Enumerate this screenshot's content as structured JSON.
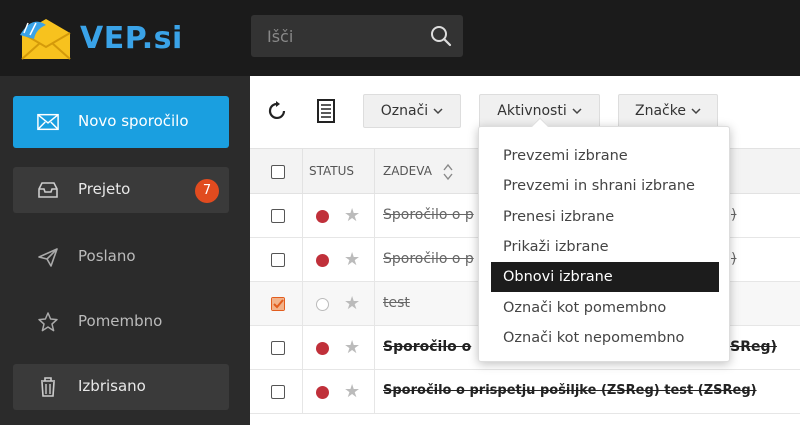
{
  "brand": {
    "name": "VEP.si",
    "accent": "#3aa3e8"
  },
  "search": {
    "placeholder": "Išči"
  },
  "sidebar": {
    "compose": {
      "label": "Novo sporočilo",
      "icon": "envelope-icon"
    },
    "items": [
      {
        "label": "Prejeto",
        "icon": "inbox-icon",
        "badge": "7"
      },
      {
        "label": "Poslano",
        "icon": "send-icon"
      },
      {
        "label": "Pomembno",
        "icon": "star-icon"
      },
      {
        "label": "Izbrisano",
        "icon": "trash-icon"
      }
    ]
  },
  "toolbar": {
    "oznaci": "Označi",
    "aktivnosti": "Aktivnosti",
    "znacke": "Značke"
  },
  "table": {
    "headers": {
      "status": "STATUS",
      "subject": "ZADEVA"
    },
    "rows": [
      {
        "checked": false,
        "status": "red",
        "subject_left": "Sporočilo o p",
        "subject_right": ")",
        "bold": false
      },
      {
        "checked": false,
        "status": "red",
        "subject_left": "Sporočilo o p",
        "subject_right": ")",
        "bold": false
      },
      {
        "checked": true,
        "status": "hollow",
        "subject_left": "test",
        "subject_right": "",
        "bold": false
      },
      {
        "checked": false,
        "status": "red",
        "subject_left": "Sporočilo o",
        "subject_right": "ZSReg)",
        "bold": true
      },
      {
        "checked": false,
        "status": "red",
        "subject_left": "Sporočilo o prispetju pošiljke (ZSReg) test (ZSReg)",
        "subject_right": "",
        "bold": true
      }
    ]
  },
  "dropdown": {
    "items": [
      "Prevzemi izbrane",
      "Prevzemi in shrani izbrane",
      "Prenesi izbrane",
      "Prikaži izbrane",
      "Obnovi izbrane",
      "Označi kot pomembno",
      "Označi kot nepomembno"
    ],
    "active_index": 4
  }
}
